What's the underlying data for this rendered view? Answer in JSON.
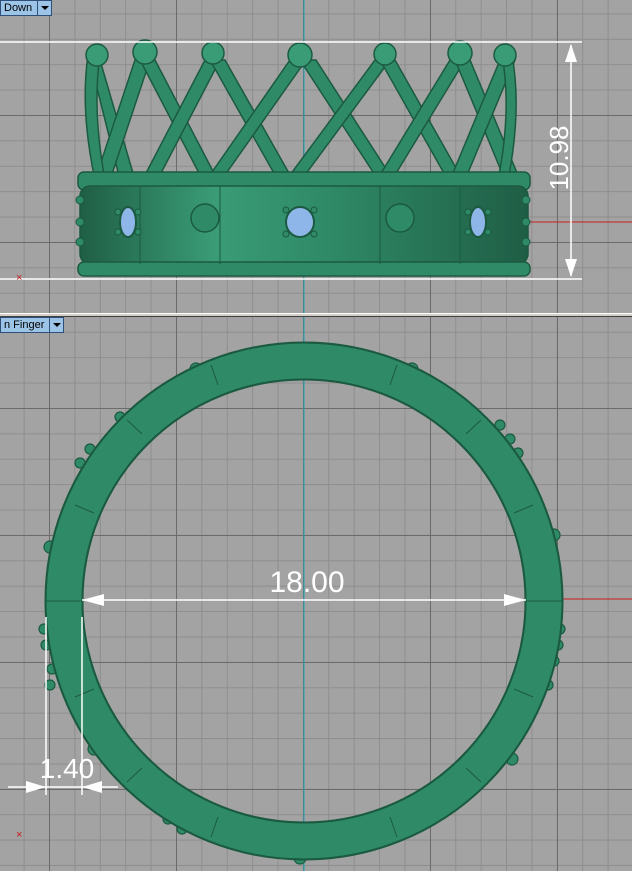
{
  "viewports": {
    "top": {
      "label": "Down"
    },
    "bottom": {
      "label": "n Finger"
    }
  },
  "dimensions": {
    "height": "10.98",
    "diameter": "18.00",
    "thickness": "1.40"
  },
  "axis_marker": "×",
  "colors": {
    "ring": "#2f8a67",
    "ring_dark": "#1e5e45",
    "gem": "#8fb6e8",
    "x_axis": "#c81e1e",
    "y_axis": "#1fa7b8",
    "dimension": "#ffffff"
  }
}
